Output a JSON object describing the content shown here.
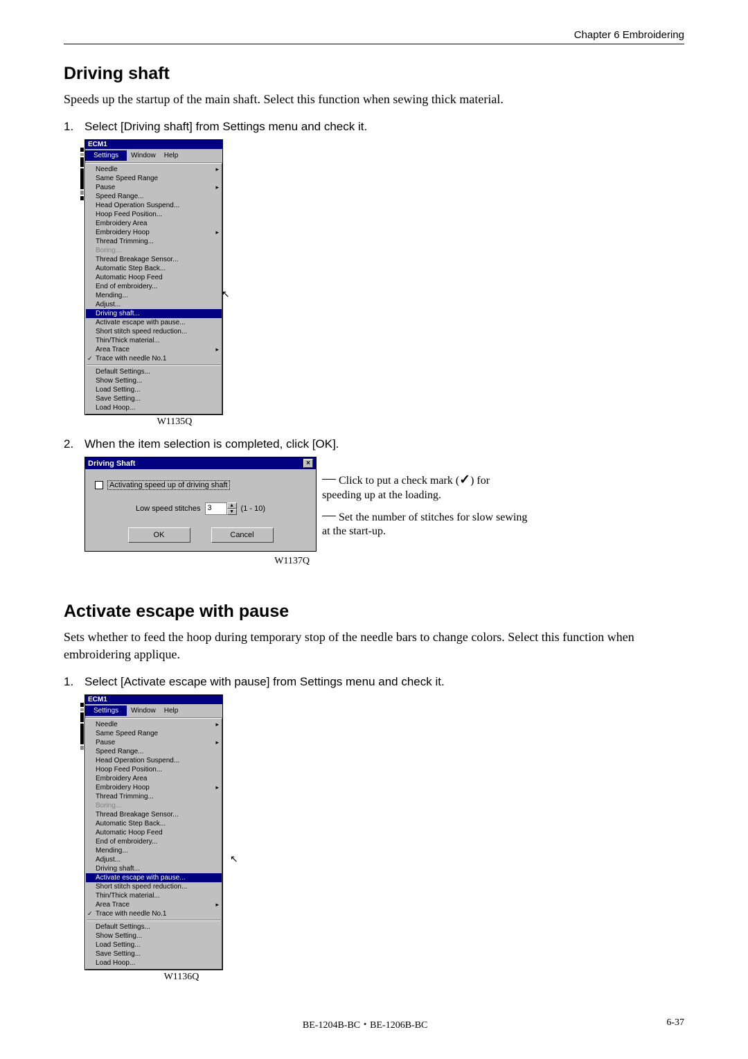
{
  "header": {
    "chapter": "Chapter 6    Embroidering"
  },
  "section1": {
    "title": "Driving shaft",
    "intro": "Speeds up the startup of the main shaft.    Select this function when sewing thick material.",
    "step1": "Select [Driving shaft] from Settings menu and check it.",
    "fig1_caption": "W1135Q",
    "step2": "When the item selection is completed, click [OK].",
    "fig2_caption": "W1137Q"
  },
  "section2": {
    "title": "Activate escape with pause",
    "intro": "Sets whether to feed the hoop during temporary stop of the needle bars to change colors.    Select this function when embroidering applique.",
    "step1": "Select [Activate escape with pause] from Settings menu and check it.",
    "fig_caption": "W1136Q"
  },
  "menu": {
    "window_title": "ECM1",
    "bar": {
      "settings": "Settings",
      "window": "Window",
      "help": "Help"
    },
    "items": {
      "needle": "Needle",
      "same_speed": "Same Speed Range",
      "pause": "Pause",
      "speed_range": "Speed Range...",
      "head_op": "Head Operation Suspend...",
      "hoop_feed": "Hoop Feed Position...",
      "emb_area": "Embroidery Area",
      "emb_hoop": "Embroidery Hoop",
      "thread_trim": "Thread Trimming...",
      "boring": "Boring...",
      "thread_break": "Thread Breakage Sensor...",
      "auto_step": "Automatic Step Back...",
      "auto_hoop": "Automatic Hoop Feed",
      "end_emb": "End of embroidery...",
      "mending": "Mending...",
      "adjust": "Adjust...",
      "driving_shaft": "Driving shaft...",
      "activate_escape": "Activate escape with pause...",
      "short_stitch": "Short stitch speed reduction...",
      "thin_thick": "Thin/Thick material...",
      "area_trace": "Area Trace",
      "trace_needle": "Trace with needle No.1",
      "default_set": "Default Settings...",
      "show_set": "Show Setting...",
      "load_set": "Load Setting...",
      "save_set": "Save Setting...",
      "load_hoop": "Load Hoop..."
    }
  },
  "dialog": {
    "title": "Driving Shaft",
    "chk_label": "Activating speed up of driving shaft",
    "num_label": "Low speed stitches",
    "num_value": "3",
    "num_range": "(1 - 10)",
    "ok": "OK",
    "cancel": "Cancel"
  },
  "annotations": {
    "a1_pre": "Click to put a check mark (",
    "a1_post": ") for speeding up at the loading.",
    "a2": "Set the number of stitches for slow sewing at the start-up."
  },
  "footer": {
    "left": "BE-1204B-BC・BE-1206B-BC",
    "right": "6-37"
  }
}
